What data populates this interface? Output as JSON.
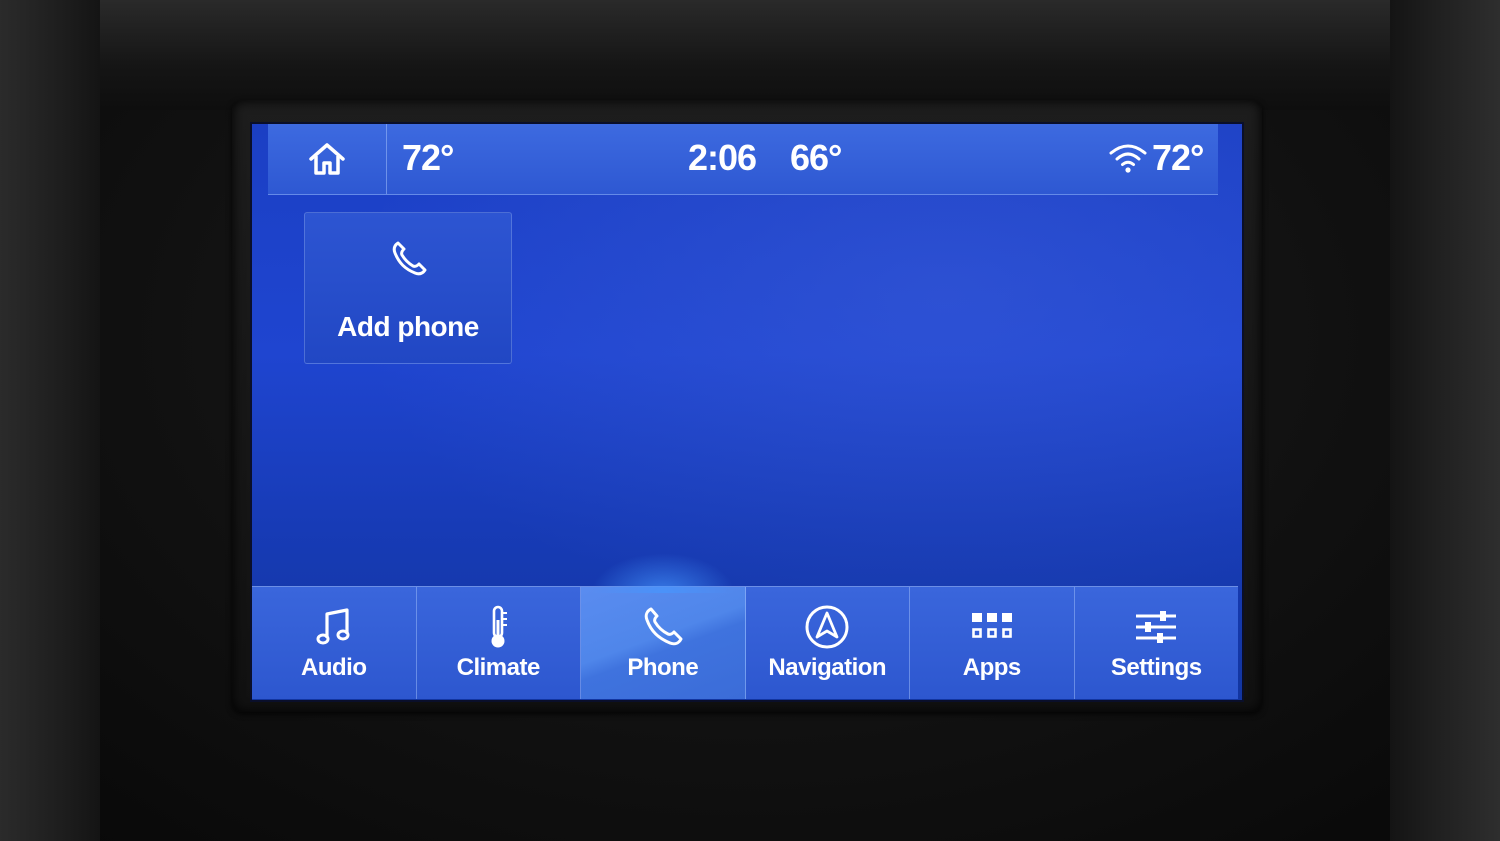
{
  "status_bar": {
    "driver_temp": "72°",
    "clock": "2:06",
    "outside_temp": "66°",
    "passenger_temp": "72°"
  },
  "main": {
    "add_phone_label": "Add phone"
  },
  "nav": {
    "items": [
      {
        "label": "Audio",
        "icon": "music-note-icon"
      },
      {
        "label": "Climate",
        "icon": "thermometer-icon"
      },
      {
        "label": "Phone",
        "icon": "phone-icon",
        "active": true
      },
      {
        "label": "Navigation",
        "icon": "navigation-compass-icon"
      },
      {
        "label": "Apps",
        "icon": "apps-grid-icon"
      },
      {
        "label": "Settings",
        "icon": "settings-sliders-icon"
      }
    ]
  },
  "colors": {
    "screen_blue": "#1f45d0",
    "bar_blue": "#3a66dc",
    "active_blue": "#4f86ea",
    "text": "#ffffff"
  }
}
